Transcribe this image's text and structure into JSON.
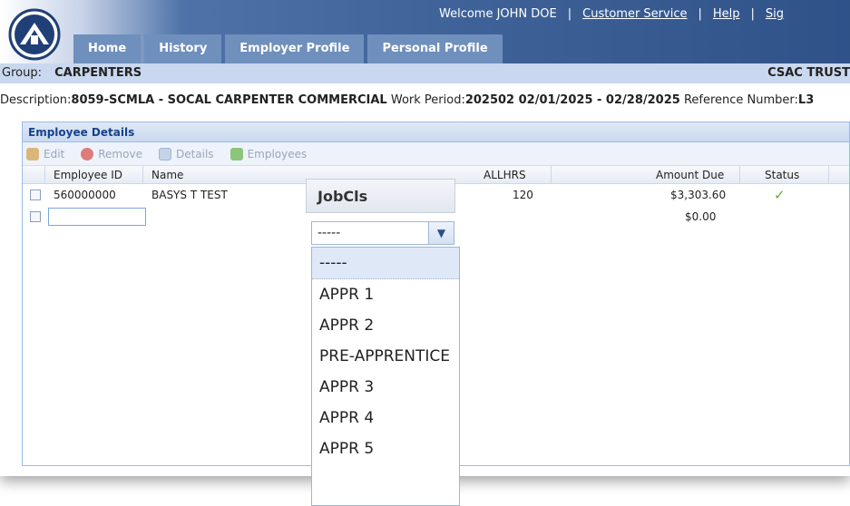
{
  "header": {
    "welcome": "Welcome JOHN DOE",
    "sep1": "|",
    "customer_service": "Customer Service",
    "sep2": "|",
    "help": "Help",
    "sep3": "|",
    "sign": "Sig",
    "tabs": [
      "Home",
      "History",
      "Employer Profile",
      "Personal Profile"
    ]
  },
  "group": {
    "label": "Group:",
    "value": "CARPENTERS",
    "trust": "CSAC TRUST"
  },
  "description": {
    "label": "Description:",
    "value": "8059-SCMLA - SOCAL CARPENTER COMMERCIAL",
    "work_period_label": "Work Period:",
    "work_period_value": "202502 02/01/2025 - 02/28/2025",
    "reference_label": "Reference Number:",
    "reference_value": "L3"
  },
  "panel": {
    "title": "Employee Details",
    "toolbar": {
      "edit": "Edit",
      "remove": "Remove",
      "details": "Details",
      "employees": "Employees"
    },
    "columns": {
      "employee_id": "Employee ID",
      "name": "Name",
      "allhrs": "ALLHRS",
      "amount_due": "Amount Due",
      "status": "Status"
    },
    "rows": [
      {
        "employee_id": "560000000",
        "name": "BASYS T TEST",
        "allhrs": "120",
        "amount_due": "$3,303.60",
        "status": "✓"
      },
      {
        "employee_id": "",
        "name": "",
        "allhrs": "",
        "amount_due": "$0.00",
        "status": ""
      }
    ]
  },
  "jobcls": {
    "header": "JobCls",
    "selected": "-----",
    "options": [
      "-----",
      "APPR 1",
      "APPR 2",
      "PRE-APPRENTICE",
      "APPR 3",
      "APPR 4",
      "APPR 5"
    ]
  },
  "colors": {
    "header_dark": "#2f5289",
    "tab_bg": "#6f8fbd",
    "group_bar": "#c9d8ee",
    "panel_title": "#15428b",
    "status_check": "#5fae2e"
  }
}
